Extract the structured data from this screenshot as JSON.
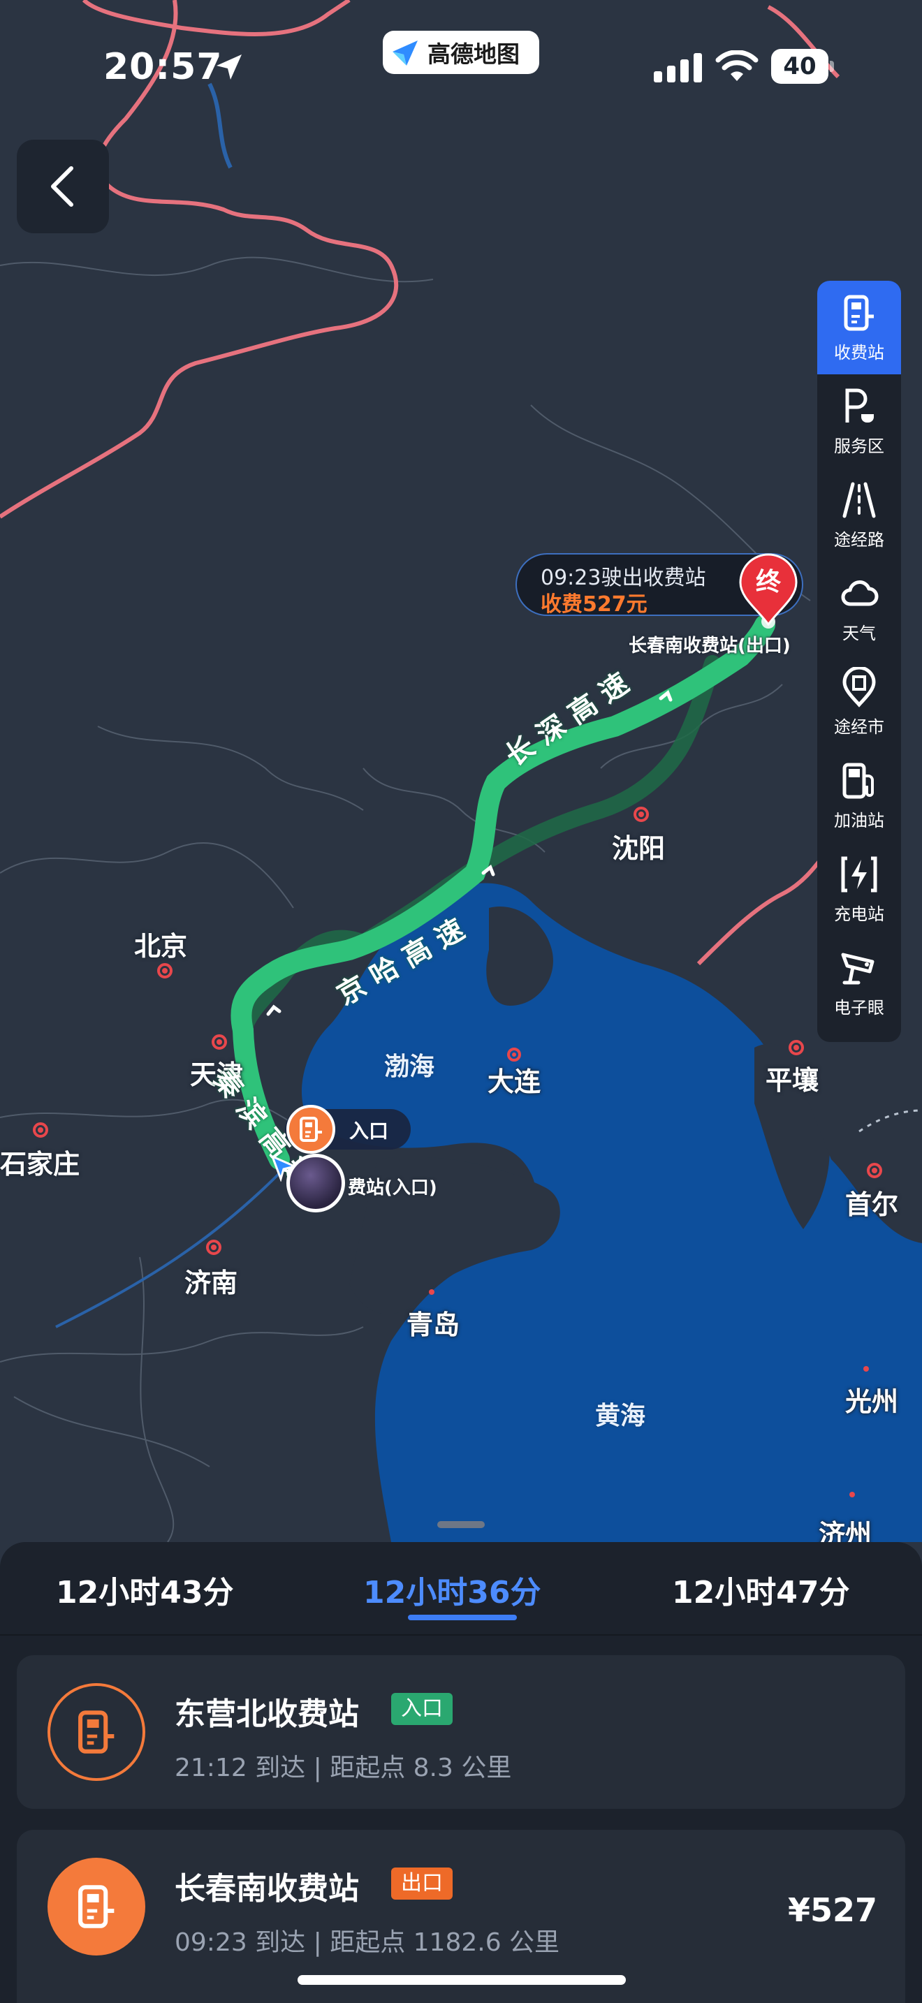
{
  "status_bar": {
    "time": "20:57",
    "app_name": "高德地图",
    "battery": "40"
  },
  "map": {
    "cities": [
      "北京",
      "天津",
      "石家庄",
      "济南",
      "青岛",
      "大连",
      "沈阳",
      "平壤",
      "首尔",
      "光州",
      "济州"
    ],
    "seas": [
      "渤海",
      "黄海"
    ],
    "roads": [
      "长深高速",
      "京哈高速",
      "秦滨高速"
    ],
    "destination": {
      "time": "09:23驶出收费站",
      "fee": "收费527元",
      "name": "长春南收费站(出口)",
      "pin_label": "终"
    },
    "start": {
      "entry_label": "入口",
      "name_visible": "费站(入口)"
    }
  },
  "side_toolbar": {
    "items": [
      "收费站",
      "服务区",
      "途经路",
      "天气",
      "途经市",
      "加油站",
      "充电站",
      "电子眼"
    ]
  },
  "route_tabs": [
    "12小时43分",
    "12小时36分",
    "12小时47分"
  ],
  "toll_stations": [
    {
      "name": "东营北收费站",
      "badge": "入口",
      "detail": "21:12 到达 | 距起点 8.3 公里",
      "price": ""
    },
    {
      "name": "长春南收费站",
      "badge": "出口",
      "detail": "09:23 到达 | 距起点 1182.6 公里",
      "price": "¥527"
    }
  ],
  "colors": {
    "accent": "#2f6bf1",
    "route": "#2fc27a",
    "toll": "#f47a3b",
    "entry_badge": "#2aa870",
    "exit_badge": "#ee6a28"
  }
}
